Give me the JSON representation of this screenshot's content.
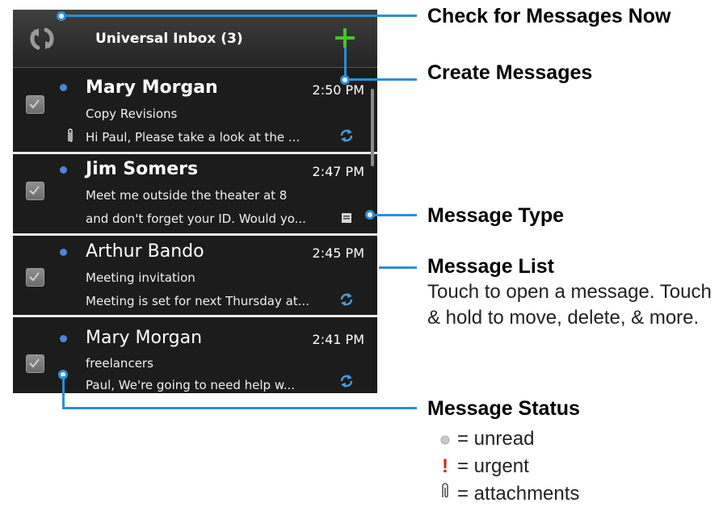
{
  "header": {
    "title": "Universal Inbox (3)",
    "refresh_icon": "refresh-icon",
    "add_icon": "plus-icon",
    "add_color": "#4cc22a"
  },
  "messages": [
    {
      "sender": "Mary Morgan",
      "time": "2:50 PM",
      "line1": "Copy Revisions",
      "line2": "Hi Paul, Please take a look at the ...",
      "unread": true,
      "attachment": true,
      "type_icon": "sync-icon"
    },
    {
      "sender": "Jim Somers",
      "time": "2:47 PM",
      "line1": "Meet me outside the theater at 8",
      "line2": "and don't forget your ID. Would yo...",
      "unread": true,
      "attachment": false,
      "type_icon": "message-icon"
    },
    {
      "sender": "Arthur Bando",
      "time": "2:45 PM",
      "line1": "Meeting invitation",
      "line2": "Meeting is set for next Thursday at...",
      "unread": true,
      "attachment": false,
      "type_icon": "sync-icon"
    },
    {
      "sender": "Mary Morgan",
      "time": "2:41 PM",
      "line1": "freelancers",
      "line2": "Paul, We're going to need help w...",
      "unread": true,
      "attachment": false,
      "type_icon": "sync-icon"
    }
  ],
  "callouts": {
    "check_messages": "Check for Messages Now",
    "create_messages": "Create Messages",
    "message_type": "Message Type",
    "message_list": "Message List",
    "message_list_desc": "Touch to open a message. Touch & hold to move, delete, & more.",
    "message_status": "Message Status"
  },
  "legend": [
    {
      "icon": "unread-dot-icon",
      "label": "= unread"
    },
    {
      "icon": "urgent-icon",
      "label": "= urgent"
    },
    {
      "icon": "attachment-icon",
      "label": "= attachments"
    }
  ],
  "colors": {
    "callout": "#2a8fd8",
    "unread_dot": "#4a86d9",
    "urgent": "#e02020",
    "background": "#1a1a1a"
  }
}
